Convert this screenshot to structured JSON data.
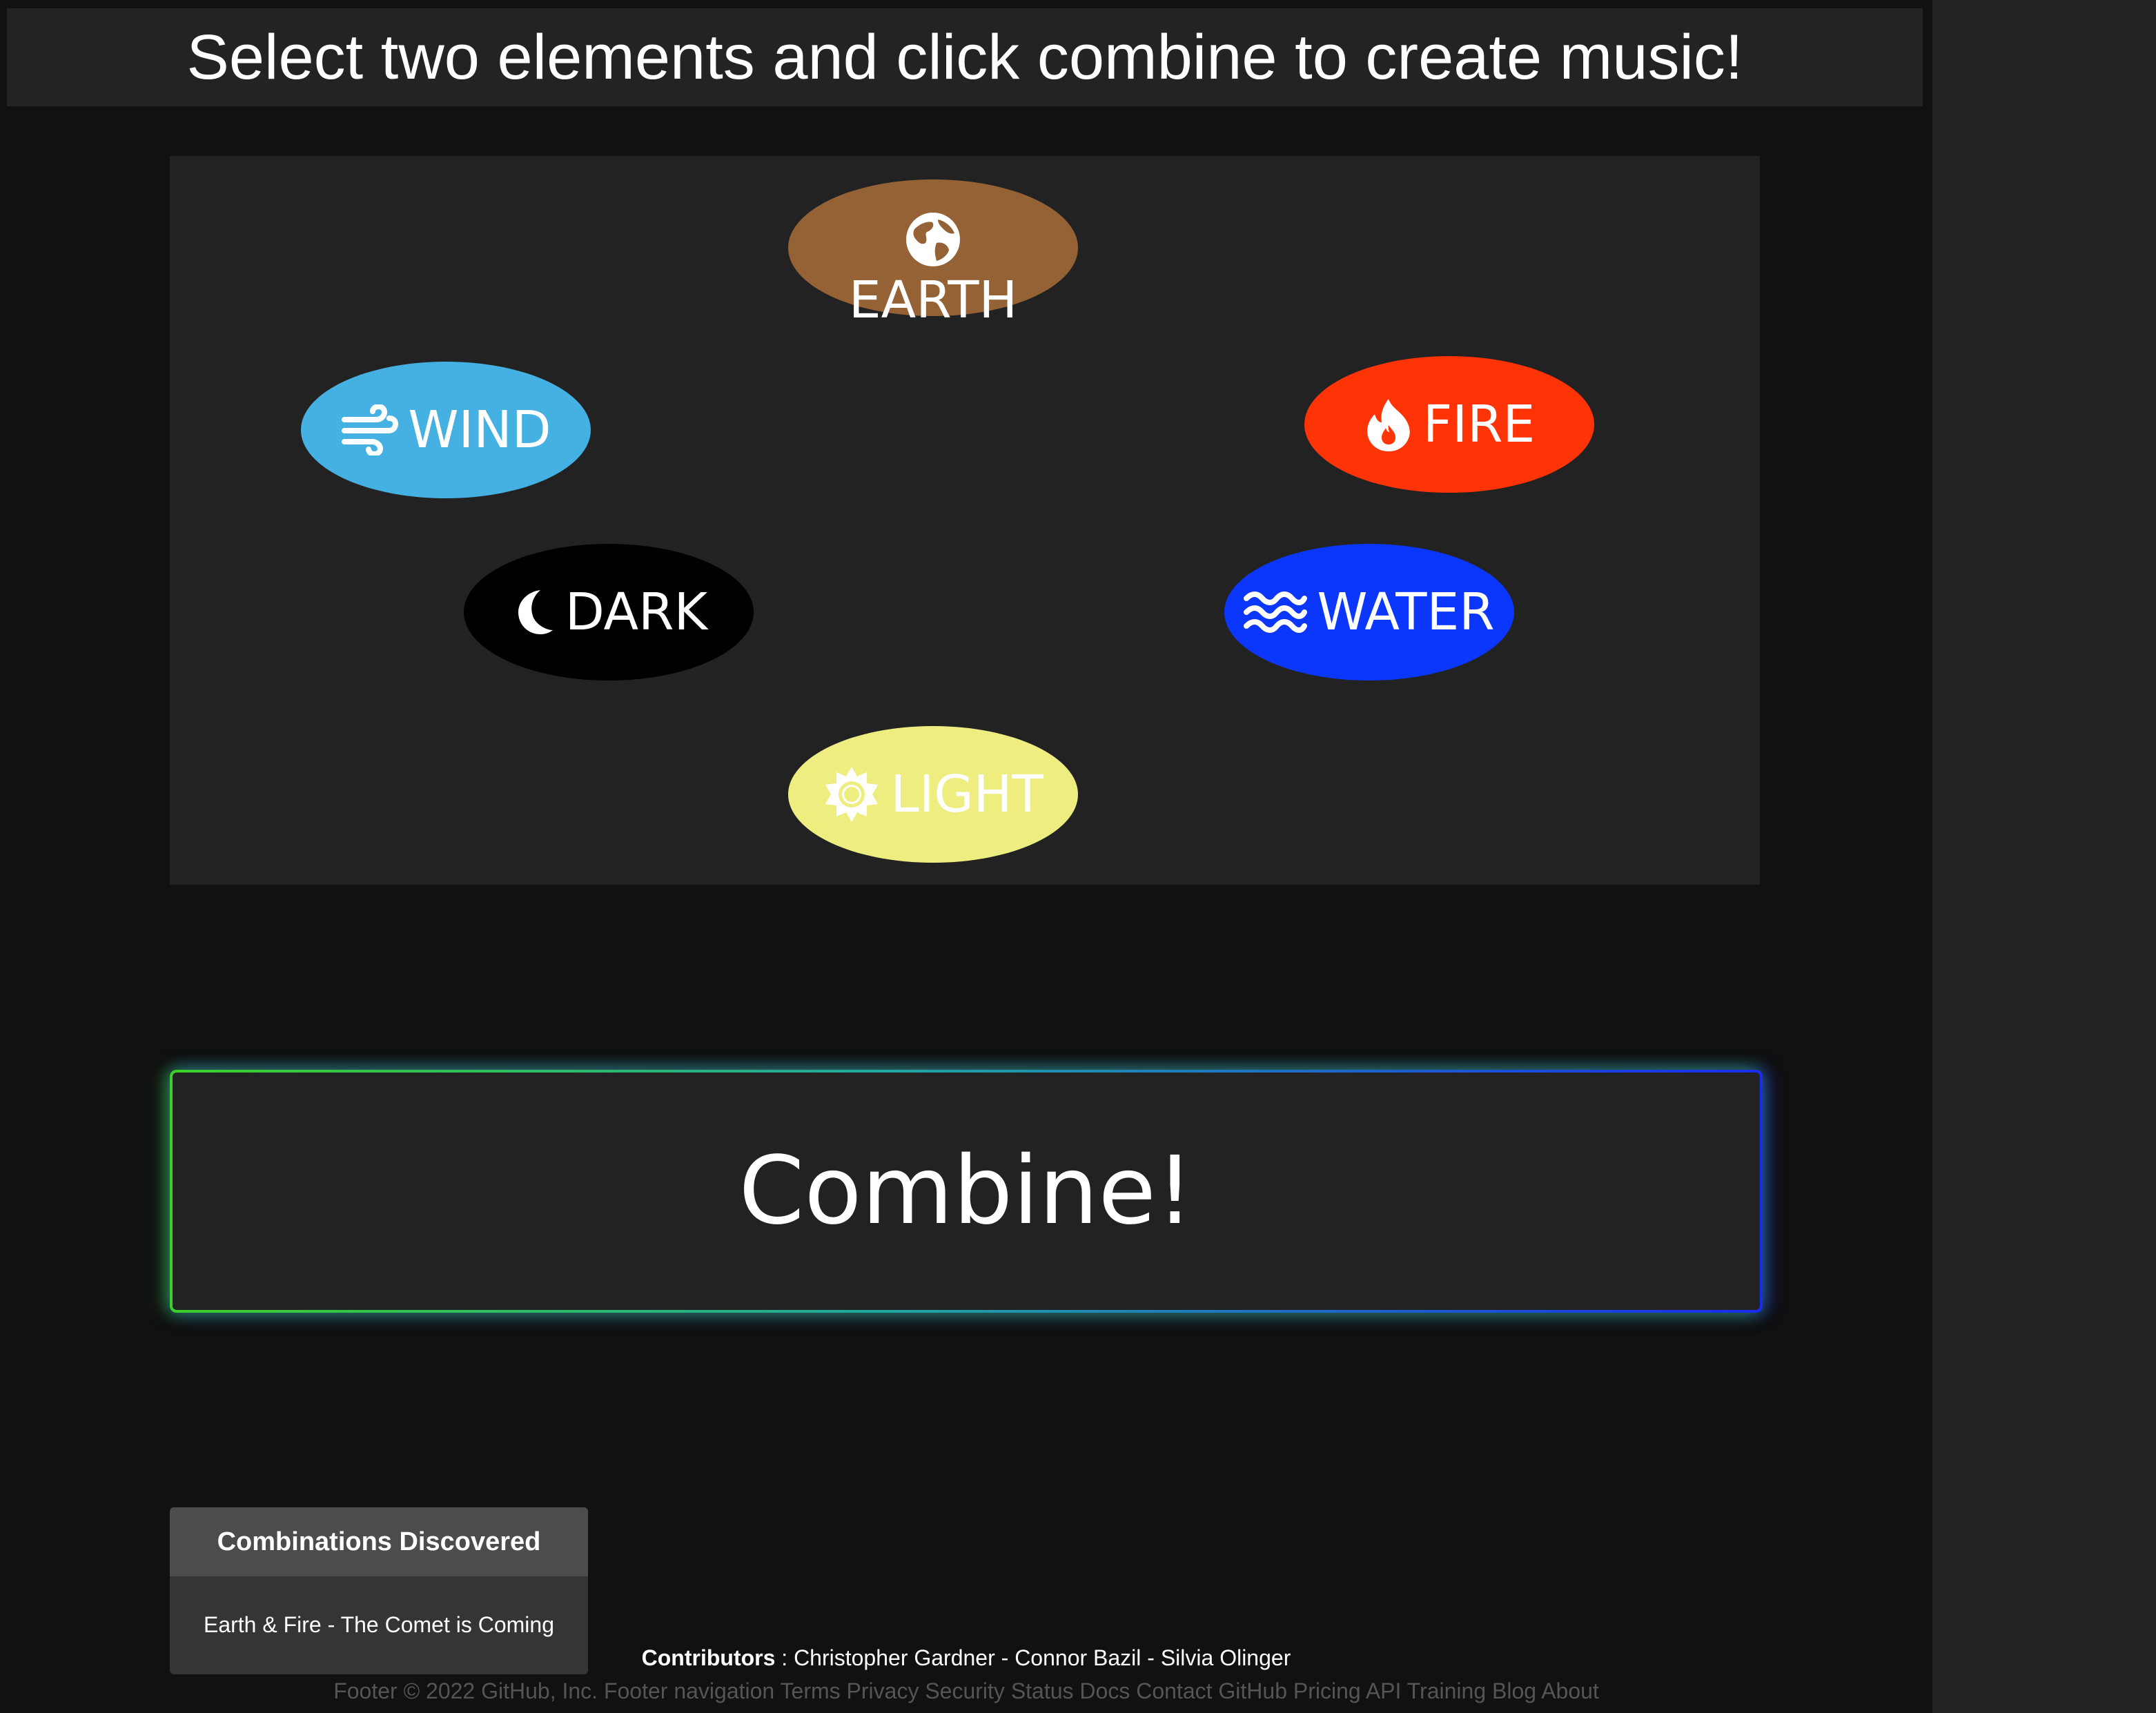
{
  "header": {
    "title": "Select two elements and click combine to create music!"
  },
  "elements": {
    "earth": {
      "label": "EARTH",
      "icon": "globe-icon",
      "color": "#946235"
    },
    "wind": {
      "label": "WIND",
      "icon": "wind-icon",
      "color": "#45b0e2"
    },
    "fire": {
      "label": "FIRE",
      "icon": "fire-icon",
      "color": "#fe3306"
    },
    "dark": {
      "label": "DARK",
      "icon": "moon-icon",
      "color": "#000000"
    },
    "water": {
      "label": "WATER",
      "icon": "water-icon",
      "color": "#0b37fc"
    },
    "light": {
      "label": "LIGHT",
      "icon": "sun-icon",
      "color": "#eeee80"
    }
  },
  "combine": {
    "label": "Combine!"
  },
  "discovered": {
    "title": "Combinations Discovered",
    "items": [
      "Earth & Fire - The Comet is Coming"
    ]
  },
  "contributors": {
    "label": "Contributors",
    "names": ": Christopher Gardner - Connor Bazil - Silvia Olinger"
  },
  "footer": {
    "copyright": "Footer © 2022 GitHub, Inc. Footer navigation",
    "links": [
      "Terms",
      "Privacy",
      "Security",
      "Status",
      "Docs",
      "Contact GitHub",
      "Pricing",
      "API",
      "Training",
      "Blog",
      "About"
    ]
  }
}
